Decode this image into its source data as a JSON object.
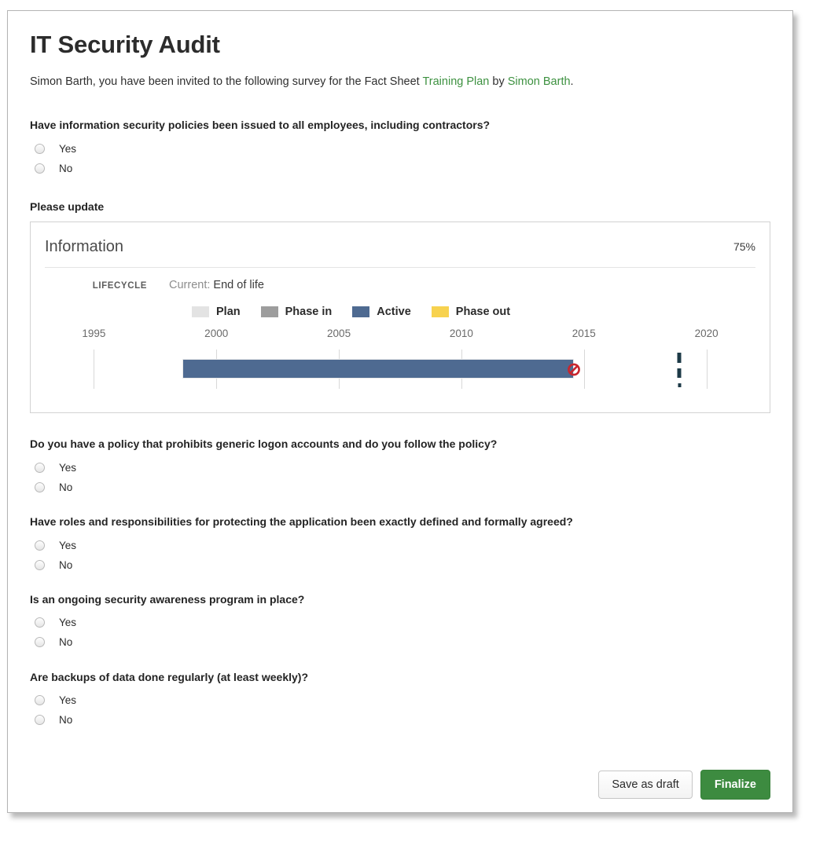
{
  "page": {
    "title": "IT Security Audit",
    "intro": {
      "prefix": "Simon Barth, you have been invited to the following survey for the Fact Sheet ",
      "fact_sheet_link": "Training Plan",
      "middle": " by ",
      "author_link": "Simon Barth",
      "suffix": "."
    }
  },
  "questions": [
    {
      "label": "Have information security policies been issued to all employees, including contractors?",
      "options": [
        "Yes",
        "No"
      ]
    },
    {
      "label": "Do you have a policy that prohibits generic logon accounts and do you follow the policy?",
      "options": [
        "Yes",
        "No"
      ]
    },
    {
      "label": "Have roles and responsibilities for protecting the application been exactly defined and formally agreed?",
      "options": [
        "Yes",
        "No"
      ]
    },
    {
      "label": "Is an ongoing security awareness program in place?",
      "options": [
        "Yes",
        "No"
      ]
    },
    {
      "label": "Are backups of data done regularly (at least weekly)?",
      "options": [
        "Yes",
        "No"
      ]
    }
  ],
  "update_section": {
    "label": "Please update",
    "card": {
      "title": "Information",
      "completion": "75%",
      "lifecycle_key": "LIFECYCLE",
      "lifecycle_current_prefix": "Current:",
      "lifecycle_current_value": "End of life"
    }
  },
  "chart_data": {
    "type": "timeline",
    "title": "Lifecycle",
    "xlabel": "",
    "ylabel": "",
    "xlim": [
      1993,
      2022
    ],
    "tick_labels": [
      "1995",
      "2000",
      "2005",
      "2010",
      "2015",
      "2020"
    ],
    "tick_values": [
      1995,
      2000,
      2005,
      2010,
      2015,
      2020
    ],
    "grid": true,
    "legend_position": "top",
    "legend": [
      {
        "label": "Plan",
        "color": "#e3e3e3"
      },
      {
        "label": "Phase in",
        "color": "#9d9d9d"
      },
      {
        "label": "Active",
        "color": "#4e6a91"
      },
      {
        "label": "Phase out",
        "color": "#f7d24f"
      }
    ],
    "series": [
      {
        "name": "Active",
        "phase": "Active",
        "color": "#4e6a91",
        "start": 1998.6,
        "end": 2014.6
      }
    ],
    "markers": [
      {
        "name": "end-of-life",
        "value": 2014.6,
        "icon": "prohibited",
        "color": "#c9252d"
      },
      {
        "name": "today",
        "value": 2018.9,
        "style": "dashed",
        "color": "#1d3a47"
      }
    ]
  },
  "footer": {
    "save_draft_label": "Save as draft",
    "finalize_label": "Finalize"
  },
  "colors": {
    "link": "#3d9140",
    "finalize": "#3d8b40",
    "active_bar": "#4e6a91",
    "eol_marker": "#c9252d"
  }
}
